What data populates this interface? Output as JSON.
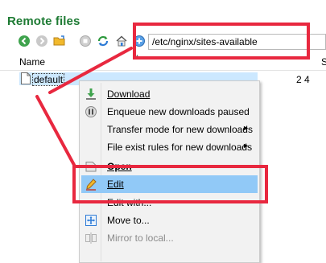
{
  "panel": {
    "title": "Remote files"
  },
  "toolbar": {
    "path_value": "/etc/nginx/sites-available",
    "icons": [
      "back-icon",
      "forward-icon",
      "open-folder-icon",
      "stop-icon",
      "refresh-icon",
      "home-icon",
      "add-bookmark-icon"
    ]
  },
  "columns": {
    "name": "Name",
    "size": "S"
  },
  "files": [
    {
      "name": "default",
      "size": "2 4"
    }
  ],
  "context_menu": {
    "items": [
      {
        "label": "Download",
        "icon": "download-icon"
      },
      {
        "label": "Enqueue new downloads paused",
        "icon": "enqueue-icon"
      },
      {
        "label": "Transfer mode for new downloads",
        "submenu": "►"
      },
      {
        "label": "File exist rules for new downloads",
        "submenu": "►"
      },
      {
        "label": "Open",
        "icon": "open-icon"
      },
      {
        "label": "Edit",
        "icon": "edit-icon",
        "highlighted": true
      },
      {
        "label": "Edit with..."
      },
      {
        "label": "Move to...",
        "icon": "move-icon"
      },
      {
        "label": "Mirror to local...",
        "icon": "mirror-icon",
        "disabled": true
      }
    ]
  },
  "colors": {
    "title": "#1e7b34",
    "annotation": "#e8283f",
    "highlight": "#91c9f7",
    "selection": "#cce8ff"
  }
}
